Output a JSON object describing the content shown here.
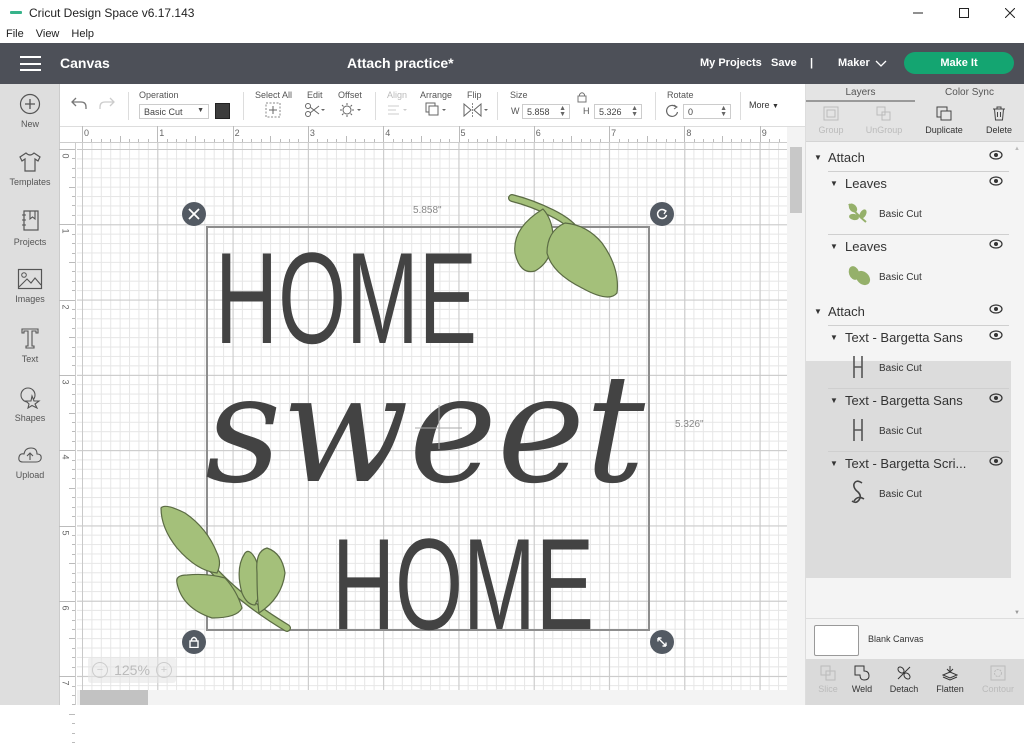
{
  "window": {
    "title": "Cricut Design Space  v6.17.143",
    "controls": [
      "minimize",
      "maximize",
      "close"
    ]
  },
  "menubar": [
    "File",
    "View",
    "Help"
  ],
  "header": {
    "section": "Canvas",
    "project_title": "Attach practice*",
    "my_projects": "My Projects",
    "save": "Save",
    "separator": "|",
    "machine": "Maker",
    "make_it": "Make It",
    "make_it_color": "#14a571"
  },
  "leftnav": [
    {
      "label": "New",
      "icon": "plus-circle-icon"
    },
    {
      "label": "Templates",
      "icon": "tshirt-icon"
    },
    {
      "label": "Projects",
      "icon": "notebook-icon"
    },
    {
      "label": "Images",
      "icon": "image-icon"
    },
    {
      "label": "Text",
      "icon": "text-t-icon"
    },
    {
      "label": "Shapes",
      "icon": "shapes-icon"
    },
    {
      "label": "Upload",
      "icon": "cloud-upload-icon"
    }
  ],
  "toolbar": {
    "operation_label": "Operation",
    "operation_value": "Basic Cut",
    "swatch_color": "#3d3d3d",
    "select_all": "Select All",
    "edit": "Edit",
    "offset": "Offset",
    "align": "Align",
    "arrange": "Arrange",
    "flip": "Flip",
    "size_label": "Size",
    "w_label": "W",
    "w_value": "5.858",
    "h_label": "H",
    "h_value": "5.326",
    "rotate_label": "Rotate",
    "rotate_value": "0",
    "more": "More"
  },
  "ruler": {
    "top": [
      "0",
      "1",
      "2",
      "3",
      "4",
      "5",
      "6",
      "7",
      "8",
      "9"
    ],
    "left": [
      "0",
      "1",
      "2",
      "3",
      "4",
      "5",
      "6",
      "7"
    ]
  },
  "canvas": {
    "width_label": "5.858\"",
    "height_label": "5.326\"",
    "word1": "HOME",
    "word2": "sweet",
    "word3": "HOME",
    "text_color": "#434343",
    "leaf_color": "#a4c07a",
    "leaf_outline": "#5b6b44",
    "zoom": "125%",
    "zoom_minus": "−",
    "zoom_plus": "+"
  },
  "panel": {
    "tabs": [
      "Layers",
      "Color Sync"
    ],
    "actions": [
      {
        "label": "Group",
        "enabled": false
      },
      {
        "label": "UnGroup",
        "enabled": false
      },
      {
        "label": "Duplicate",
        "enabled": true
      },
      {
        "label": "Delete",
        "enabled": true
      }
    ],
    "layers": [
      {
        "name": "Attach",
        "level": 0
      },
      {
        "name": "Leaves",
        "level": 1,
        "operation": "Basic Cut"
      },
      {
        "name": "Leaves",
        "level": 1,
        "operation": "Basic Cut"
      },
      {
        "name": "Attach",
        "level": 0,
        "selected": true
      },
      {
        "name": "Text - Bargetta Sans",
        "level": 1,
        "operation": "Basic Cut",
        "thumb": "H"
      },
      {
        "name": "Text - Bargetta Sans",
        "level": 1,
        "operation": "Basic Cut",
        "thumb": "H"
      },
      {
        "name": "Text - Bargetta Scri...",
        "level": 1,
        "operation": "Basic Cut",
        "thumb": "S"
      }
    ],
    "blank_canvas": "Blank Canvas",
    "bottom_actions": [
      {
        "label": "Slice",
        "enabled": false
      },
      {
        "label": "Weld",
        "enabled": true
      },
      {
        "label": "Detach",
        "enabled": true
      },
      {
        "label": "Flatten",
        "enabled": true
      },
      {
        "label": "Contour",
        "enabled": false
      }
    ]
  }
}
